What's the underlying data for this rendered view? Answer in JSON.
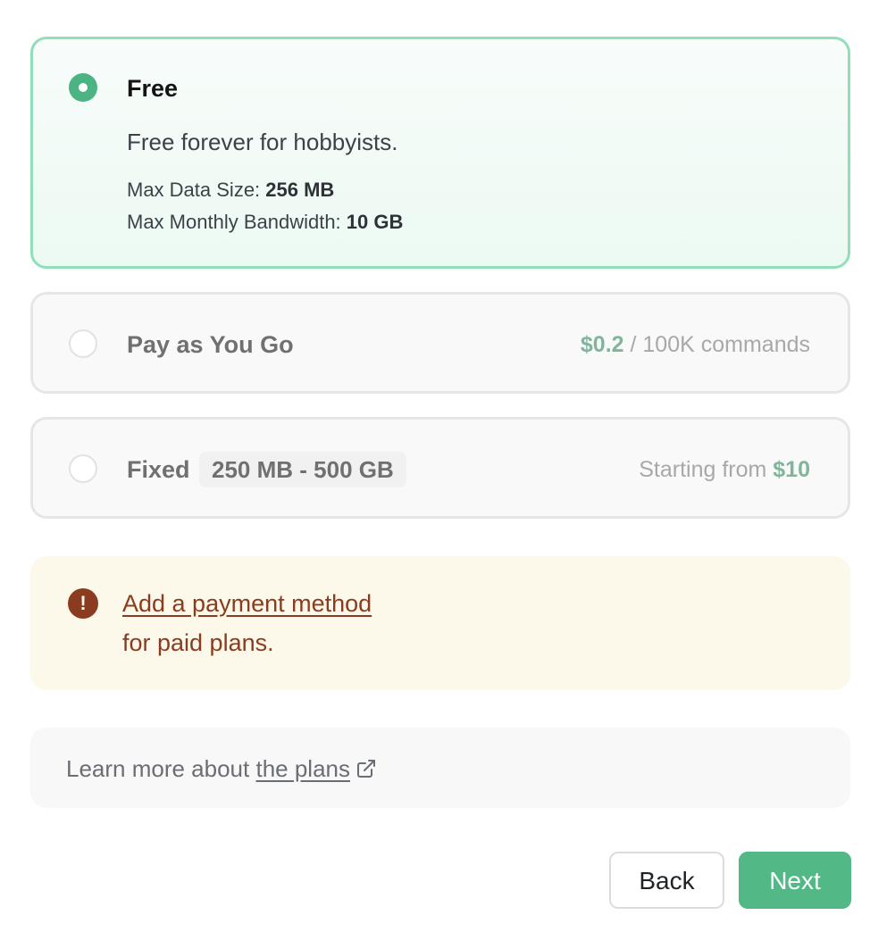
{
  "plans": {
    "free": {
      "name": "Free",
      "description": "Free forever for hobbyists.",
      "max_data_label": "Max Data Size: ",
      "max_data_value": "256 MB",
      "max_bandwidth_label": "Max Monthly Bandwidth: ",
      "max_bandwidth_value": "10 GB",
      "selected": true
    },
    "payg": {
      "name": "Pay as You Go",
      "price": "$0.2",
      "price_unit": " / 100K commands",
      "selected": false
    },
    "fixed": {
      "name": "Fixed",
      "range": "250 MB - 500 GB",
      "price_prefix": "Starting from ",
      "price": "$10",
      "selected": false
    }
  },
  "alert": {
    "icon": "exclamation-circle-icon",
    "icon_glyph": "!",
    "link_text": "Add a payment method",
    "text": "for paid plans."
  },
  "info": {
    "prefix": "Learn more about ",
    "link_text": "the plans",
    "icon": "external-link-icon"
  },
  "buttons": {
    "back": "Back",
    "next": "Next"
  },
  "colors": {
    "accent_green": "#52b886",
    "selected_border": "#8fe0b9",
    "alert_brown": "#8b3b1f",
    "alert_bg": "#fdf9ea"
  }
}
